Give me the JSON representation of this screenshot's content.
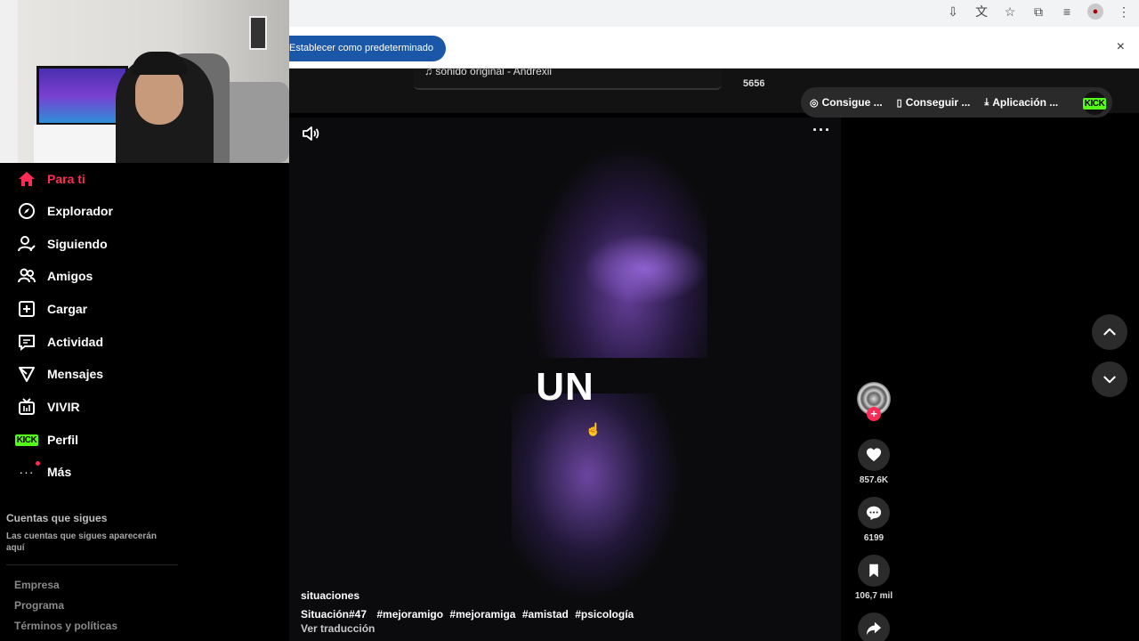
{
  "browser": {
    "infobar_button": "Establecer como predeterminado",
    "infobar_close": "×",
    "toolbar_icons": [
      "install-icon",
      "translate-icon",
      "star-icon",
      "extensions-icon",
      "media-icon",
      "profile-avatar",
      "menu-icon"
    ]
  },
  "sidebar": {
    "items": [
      {
        "label": "Para ti",
        "icon": "home-icon",
        "active": true
      },
      {
        "label": "Explorador",
        "icon": "compass-icon"
      },
      {
        "label": "Siguiendo",
        "icon": "following-icon"
      },
      {
        "label": "Amigos",
        "icon": "friends-icon"
      },
      {
        "label": "Cargar",
        "icon": "upload-icon"
      },
      {
        "label": "Actividad",
        "icon": "activity-icon"
      },
      {
        "label": "Mensajes",
        "icon": "messages-icon"
      },
      {
        "label": "VIVIR",
        "icon": "live-icon"
      },
      {
        "label": "Perfil",
        "icon": "kick-icon",
        "badge": "KICK"
      },
      {
        "label": "Más",
        "icon": "more-icon"
      }
    ],
    "following_title": "Cuentas que sigues",
    "following_desc": "Las cuentas que sigues aparecerán aquí",
    "footer_links": [
      "Empresa",
      "Programa",
      "Términos y políticas"
    ]
  },
  "feed": {
    "prev_music": "♫ sonido original - Andrexii",
    "prev_count": "5656",
    "top_pills": [
      "Consigue ...",
      "Conseguir ...",
      "Aplicación ..."
    ],
    "kick_label": "KICK",
    "video_word": "UN",
    "caption_user": "situaciones",
    "caption_prefix": "Situación#47",
    "hashtags": [
      "#mejoramigo",
      "#mejoramiga",
      "#amistad",
      "#psicología"
    ],
    "translate_label": "Ver traducción",
    "likes": "857.6K",
    "comments": "6199",
    "saves": "106,7 mil"
  },
  "colors": {
    "accent": "#fe2c55",
    "kick_green": "#53fc18",
    "infobar_blue": "#1b57a8"
  }
}
